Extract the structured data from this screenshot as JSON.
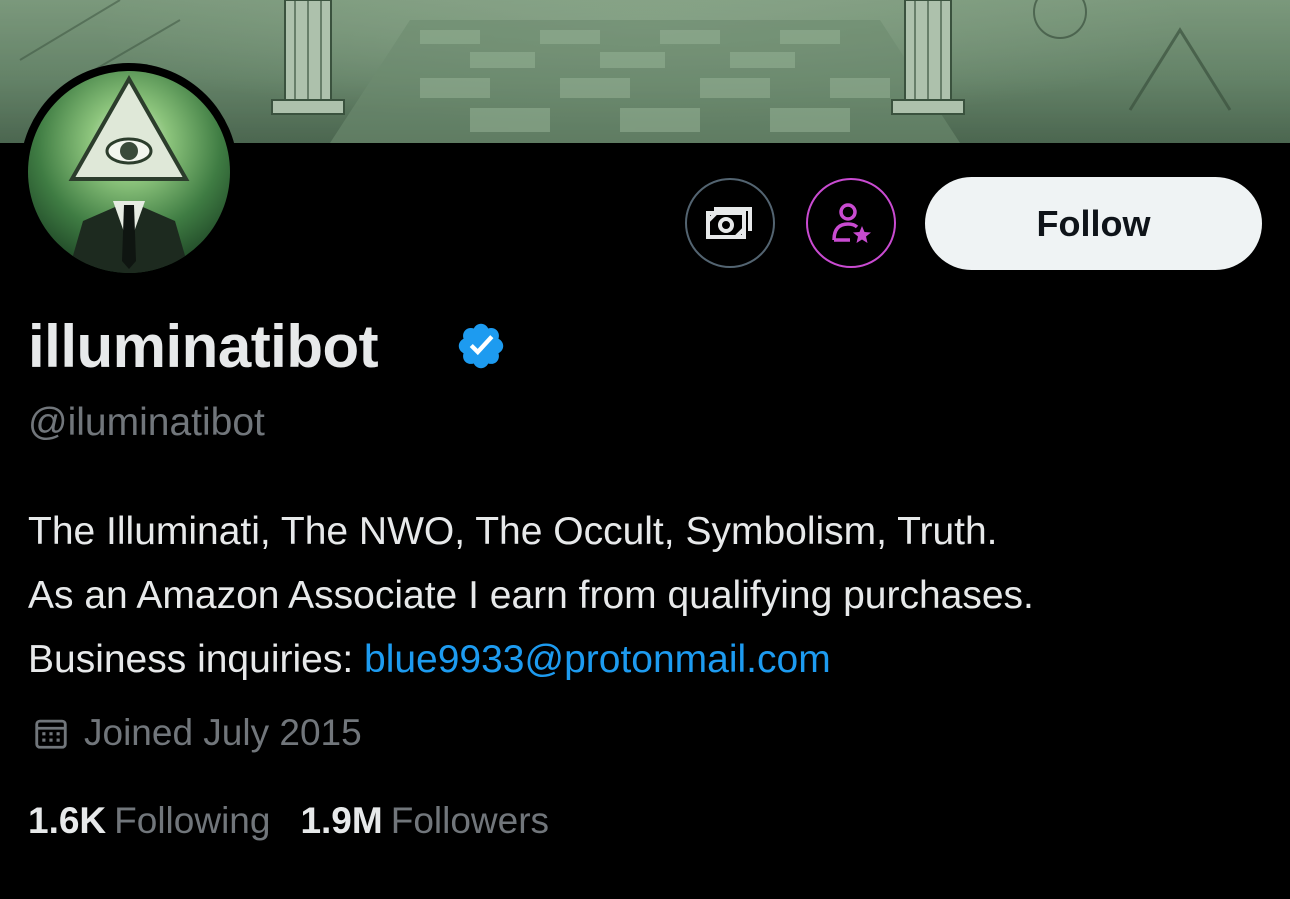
{
  "profile": {
    "display_name": "illuminatibot",
    "handle": "@iluminatibot",
    "bio_line1": "The Illuminati, The NWO, The Occult, Symbolism, Truth.",
    "bio_line2": "As an Amazon Associate I earn from qualifying purchases.",
    "bio_line3_prefix": "Business inquiries: ",
    "bio_email": "blue9933@protonmail.com",
    "joined": "Joined July 2015",
    "verified": true
  },
  "actions": {
    "follow_label": "Follow",
    "money_icon": "money-icon",
    "subscribe_icon": "person-star-icon"
  },
  "stats": {
    "following_count": "1.6K",
    "following_label": "Following",
    "followers_count": "1.9M",
    "followers_label": "Followers"
  },
  "colors": {
    "background": "#000000",
    "link": "#1d9bf0",
    "verified_badge": "#1d9bf0",
    "subscribe_accent": "#c94bd1",
    "secondary_text": "#71767b",
    "follow_button_bg": "#eff3f4"
  }
}
